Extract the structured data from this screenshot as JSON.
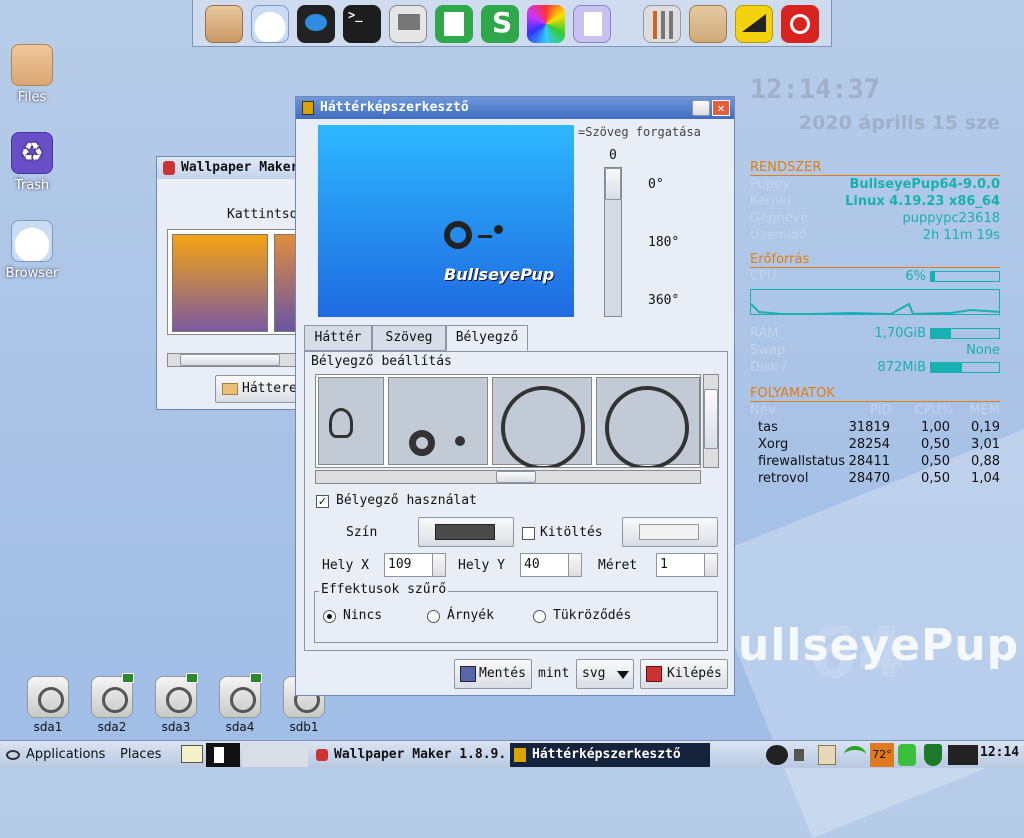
{
  "desktop": {
    "icons": [
      {
        "label": "Files"
      },
      {
        "label": "Trash"
      },
      {
        "label": "Browser"
      }
    ],
    "drives": [
      {
        "label": "sda1"
      },
      {
        "label": "sda2"
      },
      {
        "label": "sda3"
      },
      {
        "label": "sda4"
      },
      {
        "label": "sdb1"
      }
    ],
    "watermark": "ullseyePup",
    "watermark_64": "64"
  },
  "dock": {
    "items": [
      "home-icon",
      "cloud-icon",
      "chat-icon",
      "terminal-icon",
      "monitor-icon",
      "notes-icon",
      "spreadsheet-icon",
      "color-icon",
      "document-icon",
      "mixer-icon",
      "box-icon",
      "signal-icon",
      "power-icon"
    ]
  },
  "conky": {
    "time": "12:14:37",
    "date": "2020 április 15 sze",
    "system": {
      "title": "RENDSZER",
      "rows": [
        {
          "k": "Puppy",
          "v": "BullseyePup64-9.0.0"
        },
        {
          "k": "Kernel",
          "v": "Linux 4.19.23 x86_64"
        },
        {
          "k": "Gépneve",
          "v": "puppypc23618"
        },
        {
          "k": "Üzemidő",
          "v": "2h 11m 19s"
        }
      ]
    },
    "resources": {
      "title": "Erőforrás",
      "cpu_label": "CPU",
      "cpu_value": "6%",
      "cpu_pct": 6,
      "ram_label": "RAM",
      "ram_value": "1,70GiB",
      "ram_pct": 30,
      "swap_label": "Swap",
      "swap_value": "None",
      "disk_label": "Disk /",
      "disk_value": "872MiB",
      "disk_pct": 45
    },
    "processes": {
      "title": "FOLYAMATOK",
      "headers": [
        "Név",
        "PID",
        "CPU%",
        "MEM"
      ],
      "rows": [
        [
          "tas",
          "31819",
          "1,00",
          "0,19"
        ],
        [
          "Xorg",
          "28254",
          "0,50",
          "3,01"
        ],
        [
          "firewallstatus",
          "28411",
          "0,50",
          "0,88"
        ],
        [
          "retrovol",
          "28470",
          "0,50",
          "1,04"
        ]
      ]
    }
  },
  "bg_window": {
    "title": "Wallpaper Maker",
    "click_text": "Kattintso",
    "button": "Háttere"
  },
  "main_window": {
    "title": "Háttérképszerkesztő",
    "preview_logo": "BullseyePup",
    "rotation": {
      "label": "=Szöveg forgatása",
      "value": "0",
      "ticks": [
        "0°",
        "180°",
        "360°"
      ]
    },
    "tabs": [
      "Háttér",
      "Szöveg",
      "Bélyegző"
    ],
    "stamp_settings": "Bélyegző beállítás",
    "use_stamp": "Bélyegző használat",
    "color_label": "Szín",
    "fill_label": "Kitöltés",
    "pos_x_label": "Hely X",
    "pos_x": "109",
    "pos_y_label": "Hely Y",
    "pos_y": "40",
    "size_label": "Méret",
    "size": "1",
    "effects_title": "Effektusok szűrő",
    "effects": [
      "Nincs",
      "Árnyék",
      "Tükröződés"
    ],
    "save_label": "Mentés",
    "as_label": "mint",
    "format": "svg",
    "quit_label": "Kilépés"
  },
  "taskbar": {
    "apps": "Applications",
    "places": "Places",
    "tasks": [
      "Wallpaper Maker 1.8.9.",
      "Háttérképszerkesztő"
    ],
    "temp": "72°",
    "clock": "12:14"
  }
}
